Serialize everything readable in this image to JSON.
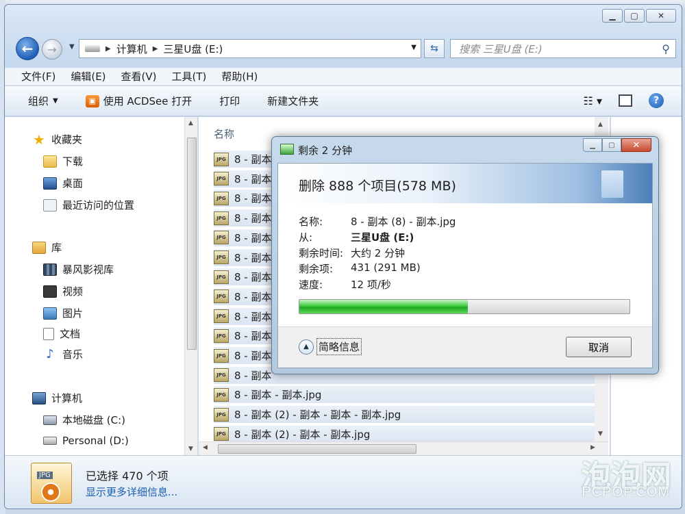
{
  "address": {
    "crumbs": [
      "计算机",
      "三星U盘 (E:)"
    ],
    "search_placeholder": "搜索 三星U盘 (E:)"
  },
  "menu": [
    "文件(F)",
    "编辑(E)",
    "查看(V)",
    "工具(T)",
    "帮助(H)"
  ],
  "toolbar": {
    "organize": "组织",
    "open_with": "使用 ACDSee 打开",
    "print": "打印",
    "new_folder": "新建文件夹"
  },
  "nav": {
    "favorites": "收藏夹",
    "downloads": "下载",
    "desktop": "桌面",
    "recent": "最近访问的位置",
    "libraries": "库",
    "storm": "暴风影视库",
    "videos": "视频",
    "pictures": "图片",
    "documents": "文档",
    "music": "音乐",
    "computer": "计算机",
    "local_disk": "本地磁盘 (C:)",
    "personal": "Personal (D:)"
  },
  "filelist": {
    "column_name": "名称",
    "rows": [
      "8 - 副本",
      "8 - 副本",
      "8 - 副本",
      "8 - 副本",
      "8 - 副本",
      "8 - 副本",
      "8 - 副本",
      "8 - 副本",
      "8 - 副本",
      "8 - 副本",
      "8 - 副本",
      "8 - 副本",
      "8 - 副本 - 副本.jpg",
      "8 - 副本 (2) - 副本 - 副本 - 副本.jpg",
      "8 - 副本 (2) - 副本 - 副本.jpg"
    ],
    "file_tag": "JPG"
  },
  "details": {
    "selected": "已选择 470 个项",
    "more_details": "显示更多详细信息...",
    "file_tag": "JPG"
  },
  "dialog": {
    "title": "剩余 2 分钟",
    "header": "删除 888 个项目(578 MB)",
    "labels": {
      "name": "名称:",
      "from": "从:",
      "time_left": "剩余时间:",
      "items_left": "剩余项:",
      "speed": "速度:"
    },
    "values": {
      "name": "8 - 副本 (8) - 副本.jpg",
      "from": "三星U盘 (E:)",
      "time_left": "大约 2 分钟",
      "items_left": "431 (291 MB)",
      "speed": "12 项/秒"
    },
    "progress_fraction": 0.51,
    "more_info": "简略信息",
    "cancel": "取消"
  },
  "watermark": {
    "main": "泡泡网",
    "sub": "PCPOP.COM"
  }
}
